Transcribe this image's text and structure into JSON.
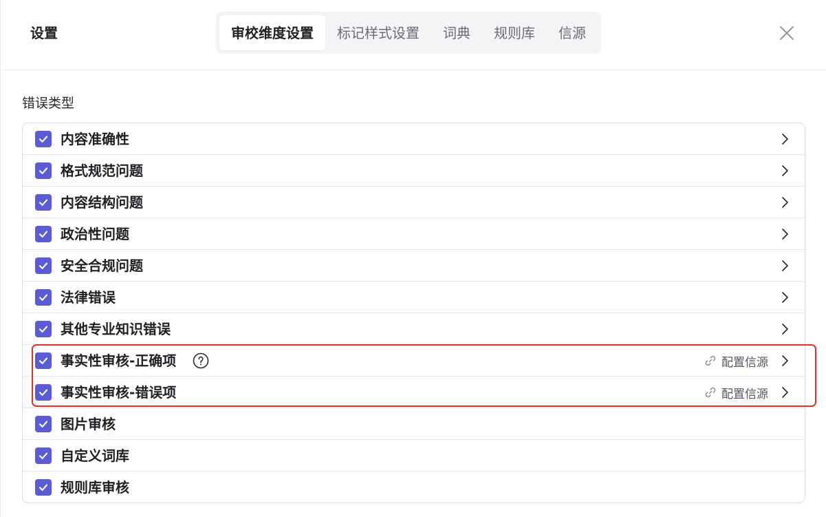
{
  "dialog": {
    "title": "设置",
    "tabs": [
      {
        "label": "审校维度设置",
        "active": true
      },
      {
        "label": "标记样式设置",
        "active": false
      },
      {
        "label": "词典",
        "active": false
      },
      {
        "label": "规则库",
        "active": false
      },
      {
        "label": "信源",
        "active": false
      }
    ],
    "close_icon": "close-icon"
  },
  "section": {
    "label": "错误类型"
  },
  "error_types": [
    {
      "label": "内容准确性",
      "checked": true,
      "chevron": true
    },
    {
      "label": "格式规范问题",
      "checked": true,
      "chevron": true
    },
    {
      "label": "内容结构问题",
      "checked": true,
      "chevron": true
    },
    {
      "label": "政治性问题",
      "checked": true,
      "chevron": true
    },
    {
      "label": "安全合规问题",
      "checked": true,
      "chevron": true
    },
    {
      "label": "法律错误",
      "checked": true,
      "chevron": true
    },
    {
      "label": "其他专业知识错误",
      "checked": true,
      "chevron": true
    },
    {
      "label": "事实性审核-正确项",
      "checked": true,
      "chevron": true,
      "help": true,
      "source_link": "配置信源"
    },
    {
      "label": "事实性审核-错误项",
      "checked": true,
      "chevron": true,
      "source_link": "配置信源"
    },
    {
      "label": "图片审核",
      "checked": true,
      "chevron": false
    },
    {
      "label": "自定义词库",
      "checked": true,
      "chevron": false
    },
    {
      "label": "规则库审核",
      "checked": true,
      "chevron": false
    }
  ],
  "colors": {
    "accent": "#5b5bd6",
    "highlight_border": "#e0302a",
    "tab_bar_bg": "#f4f4f6"
  }
}
